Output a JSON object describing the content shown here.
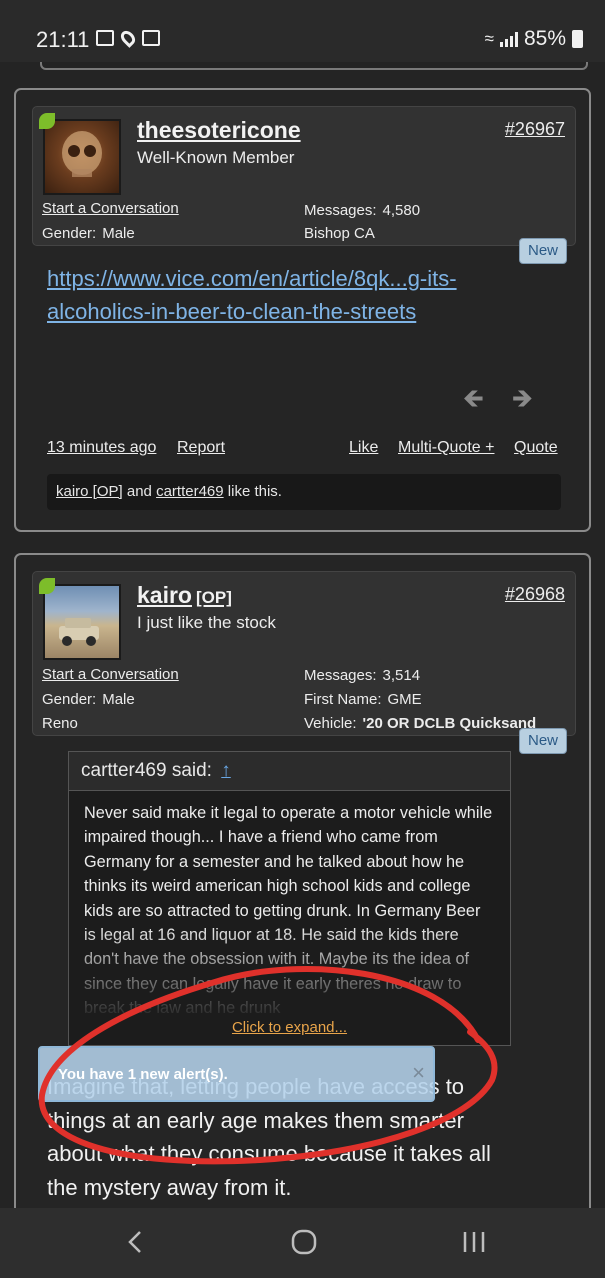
{
  "status_bar": {
    "time": "21:11",
    "battery": "85%"
  },
  "posts": [
    {
      "username": "theesotericone",
      "user_title": "Well-Known Member",
      "post_number": "#26967",
      "start_conversation": "Start a Conversation",
      "gender_label": "Gender:",
      "gender": "Male",
      "messages_label": "Messages:",
      "messages": "4,580",
      "location": "Bishop CA",
      "new_badge": "New",
      "link_line1": "https://www.vice.com/en/article/8qk...g-its-",
      "link_line2": "alcoholics-in-beer-to-clean-the-streets",
      "time_ago": "13 minutes ago",
      "report": "Report",
      "like": "Like",
      "multi_quote": "Multi-Quote +",
      "quote": "Quote",
      "likes": {
        "user1": "kairo [OP]",
        "and": " and ",
        "user2": "cartter469",
        "suffix": " like this."
      }
    },
    {
      "username": "kairo",
      "op_tag": "[OP]",
      "user_title": "I just like the stock",
      "post_number": "#26968",
      "start_conversation": "Start a Conversation",
      "gender_label": "Gender:",
      "gender": "Male",
      "location": "Reno",
      "messages_label": "Messages:",
      "messages": "3,514",
      "first_name_label": "First Name:",
      "first_name": "GME",
      "vehicle_label": "Vehicle:",
      "vehicle": "'20 OR DCLB Quicksand",
      "new_badge": "New",
      "quote": {
        "author": "cartter469 said:",
        "up_arrow": "↑",
        "text": "Never said make it legal to operate a motor vehicle while impaired though... I have a friend who came from Germany for a semester and he talked about how he thinks its weird american high school kids and college kids are so attracted to getting drunk. In Germany Beer is legal at 16 and liquor at 18. He said the kids there don't have the obsession with it. Maybe its the idea of since they can legally have it early theres no draw to break the law and he drunk",
        "expand": "Click to expand..."
      },
      "body": "Imagine that, letting people have access to things at an early age makes them smarter about what they consume because it takes all the mystery away from it."
    }
  ],
  "alert": {
    "text": "You have 1 new alert(s).",
    "close": "×"
  },
  "colors": {
    "link": "#7fb4e6",
    "annotation": "#e0312b",
    "badge": "#b8cfe0",
    "online": "#7dbd2a"
  }
}
